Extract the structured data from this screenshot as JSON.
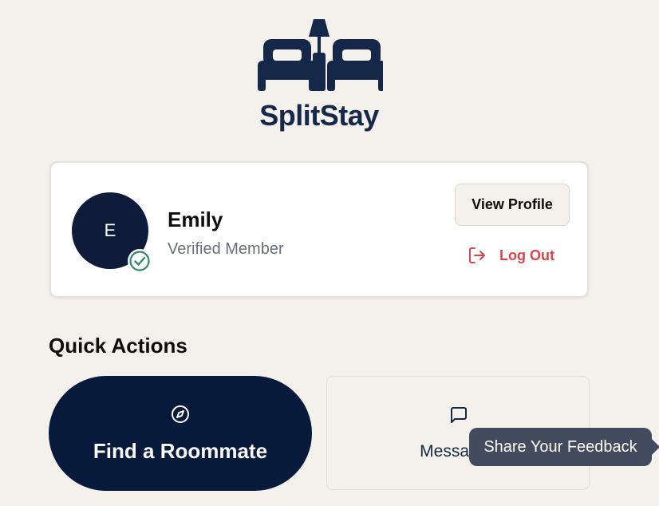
{
  "brand": {
    "name": "SplitStay",
    "logo_icon": "beds-lamp-icon",
    "logo_color": "#16284a"
  },
  "profile": {
    "avatar_initial": "E",
    "name": "Emily",
    "role": "Verified Member",
    "verified_icon": "check-circle-icon",
    "view_profile_label": "View Profile",
    "logout_label": "Log Out",
    "logout_icon": "logout-icon",
    "logout_color": "#e0424a"
  },
  "quick_actions": {
    "title": "Quick Actions",
    "items": [
      {
        "label": "Find a Roommate",
        "icon": "compass-icon"
      },
      {
        "label": "Messages",
        "icon": "message-square-icon"
      }
    ]
  },
  "feedback": {
    "label": "Share Your Feedback"
  },
  "colors": {
    "background": "#f4f0eb",
    "navy": "#071a3c",
    "verified": "#2f8a67"
  }
}
